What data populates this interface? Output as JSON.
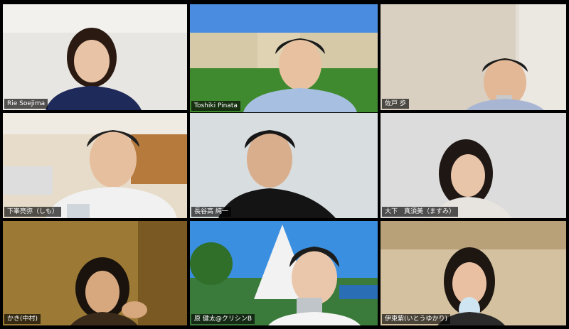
{
  "participants": [
    {
      "name": "Rie Soejima"
    },
    {
      "name": "Toshiki  Pinata"
    },
    {
      "name": "佐戸 歩"
    },
    {
      "name": "下峯亮弥（しも）"
    },
    {
      "name": "長谷高 純一"
    },
    {
      "name": "大下　真須美（ますみ）"
    },
    {
      "name": "かき(中村)"
    },
    {
      "name": "原 健太@クリシンB"
    },
    {
      "name": "伊東紫(いとうゆかり)"
    }
  ],
  "active_speaker": "Toshiki  Pinata",
  "colors": {
    "active_border": "#d6e24a",
    "background": "#000000"
  }
}
